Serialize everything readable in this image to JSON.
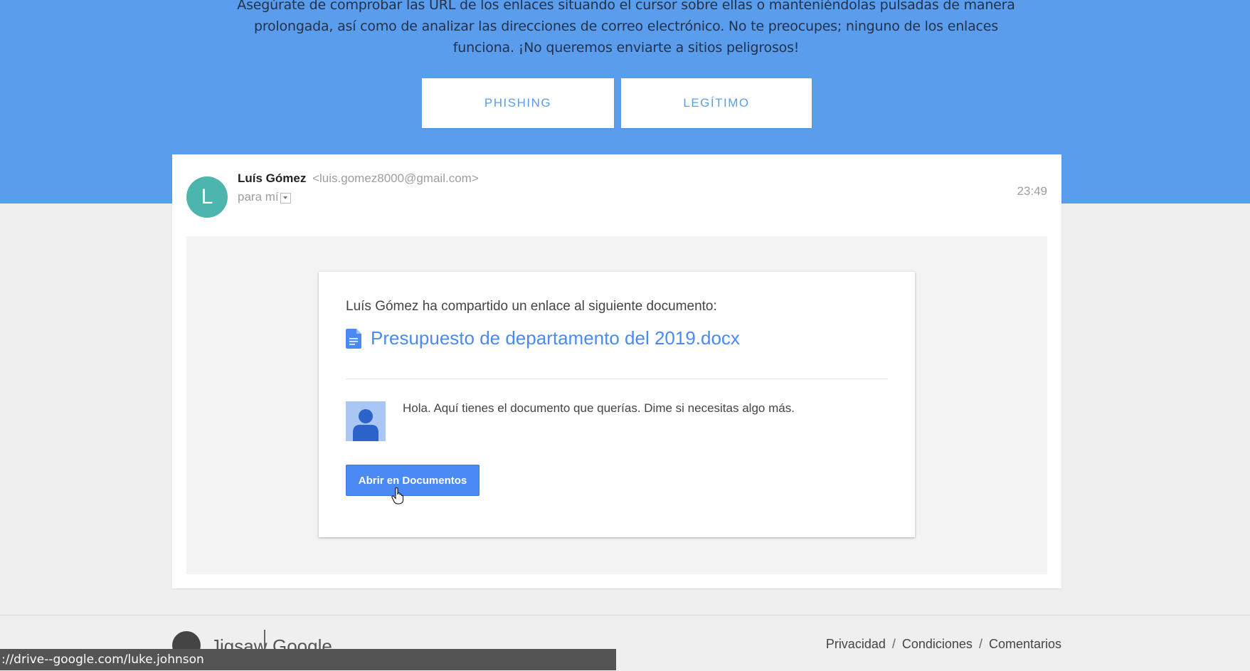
{
  "quiz": {
    "instructions": "Asegúrate de comprobar las URL de los enlaces situando el cursor sobre ellas o manteniéndolas pulsadas de manera prolongada, así como de analizar las direcciones de correo electrónico. No te preocupes; ninguno de los enlaces funciona. ¡No queremos enviarte a sitios peligrosos!",
    "phishing_label": "PHISHING",
    "legit_label": "LEGÍTIMO"
  },
  "email": {
    "avatar_letter": "L",
    "sender_name": "Luís Gómez",
    "sender_email": "<luis.gomez8000@gmail.com>",
    "recipient": "para mí",
    "time": "23:49"
  },
  "share_card": {
    "intro": "Luís Gómez ha compartido un enlace al siguiente documento:",
    "doc_title": "Presupuesto de departamento del 2019.docx",
    "message": "Hola. Aquí tienes el documento que querías. Dime si necesitas algo más.",
    "open_button": "Abrir en Documentos"
  },
  "footer": {
    "brand_jigsaw": "Jigsaw",
    "brand_google": "Google",
    "links": [
      "Privacidad",
      "Condiciones",
      "Comentarios"
    ],
    "separator": "/"
  },
  "status_bar": {
    "url": "://drive--google.com/luke.johnson"
  },
  "colors": {
    "hero_blue": "#5b9ded",
    "link_blue": "#4a8af4",
    "avatar_teal": "#4db6ac"
  }
}
